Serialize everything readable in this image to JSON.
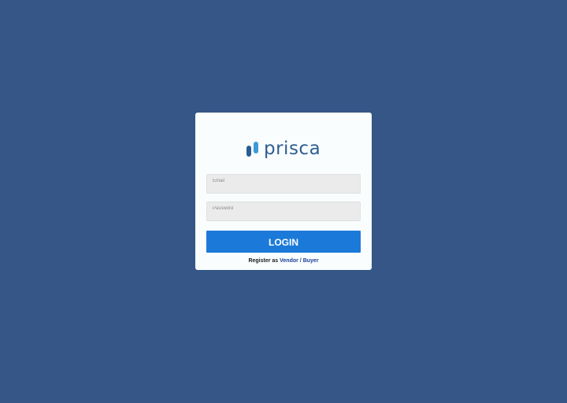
{
  "logo": {
    "text": "prisca"
  },
  "form": {
    "email_placeholder": "Email",
    "password_placeholder": "Password",
    "login_label": "LOGIN"
  },
  "register": {
    "prefix": "Register as ",
    "vendor_label": "Vendor",
    "separator": " / ",
    "buyer_label": "Buyer"
  },
  "colors": {
    "background": "#355687",
    "card": "#f9fdfd",
    "button": "#1b7ad9",
    "logo_primary": "#2a5d93",
    "logo_accent": "#3e9ad6",
    "link": "#1b3f9c"
  },
  "icons": {
    "logo_mark": "prisca-logo-icon"
  }
}
